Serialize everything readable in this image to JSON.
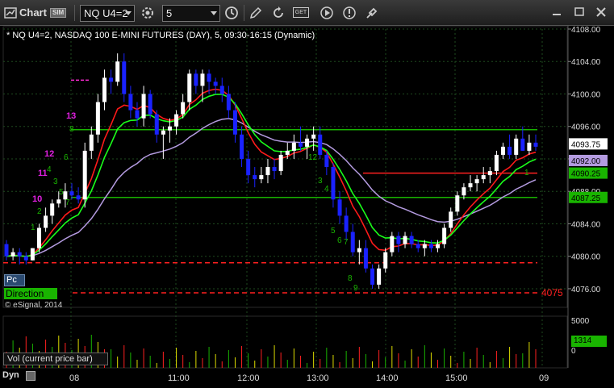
{
  "toolbar": {
    "app_label": "Chart",
    "badge": "SIM",
    "symbol_value": "NQ U4=2",
    "interval_value": "5",
    "news_label": "GET"
  },
  "chart": {
    "header": "* NQ U4=2, NASDAQ 100 E-MINI FUTURES (DAY), 5, 09:30-16:15 (Dynamic)",
    "price_ticks": [
      "4108.00",
      "4104.00",
      "4100.00",
      "4096.00",
      "4092.00",
      "4088.00",
      "4084.00",
      "4080.00",
      "4076.00"
    ],
    "last_price": "4093.75",
    "second_price": "4092.00",
    "level_4090": "4090.25",
    "level_4087": "4087.25",
    "level_4075": "4075",
    "time_labels": [
      "08",
      "11:00",
      "12:00",
      "13:00",
      "14:00",
      "15:00",
      "09"
    ],
    "indicators": {
      "pc": "Pc",
      "direction": "Direction"
    },
    "copyright": "© eSignal, 2014",
    "vol_label": "Vol (current price bar)",
    "vol_ticks": [
      "5000",
      "0"
    ],
    "vol_value": "1314",
    "bottom_label": "Dyn",
    "counts_magenta": [
      "13",
      "12",
      "11",
      "10"
    ],
    "counts_green": [
      "8",
      "4",
      "3",
      "5",
      "6",
      "7",
      "1",
      "2",
      "12",
      "3",
      "4",
      "5",
      "6",
      "7",
      "8",
      "9",
      "1"
    ]
  },
  "chart_data": {
    "type": "candlestick",
    "ylim": [
      4075,
      4108
    ],
    "candles": [
      [
        4081.5,
        4082,
        4079.5,
        4080
      ],
      [
        4080,
        4081,
        4079.5,
        4080.5
      ],
      [
        4080.5,
        4081,
        4079,
        4080
      ],
      [
        4080,
        4080.5,
        4079,
        4079.5
      ],
      [
        4079.5,
        4081,
        4079.5,
        4081
      ],
      [
        4081,
        4084,
        4080.5,
        4083.5
      ],
      [
        4083.5,
        4086,
        4083,
        4085
      ],
      [
        4085,
        4087,
        4084,
        4086.5
      ],
      [
        4086.5,
        4088,
        4086,
        4087
      ],
      [
        4087,
        4089,
        4086,
        4088
      ],
      [
        4088,
        4089,
        4087,
        4087.5
      ],
      [
        4087.5,
        4088.5,
        4086.5,
        4087
      ],
      [
        4087,
        4094,
        4086,
        4093
      ],
      [
        4093,
        4096,
        4092,
        4095
      ],
      [
        4095,
        4100,
        4094,
        4099
      ],
      [
        4099,
        4103,
        4098,
        4102
      ],
      [
        4102,
        4103,
        4100,
        4101.5
      ],
      [
        4101.5,
        4105,
        4101,
        4104
      ],
      [
        4104,
        4105,
        4099,
        4100
      ],
      [
        4100,
        4101,
        4097,
        4098
      ],
      [
        4098,
        4099,
        4096,
        4097
      ],
      [
        4097,
        4101,
        4096,
        4100
      ],
      [
        4100,
        4100.5,
        4097,
        4097.5
      ],
      [
        4097.5,
        4098,
        4094,
        4095
      ],
      [
        4095,
        4096,
        4092,
        4095.5
      ],
      [
        4095.5,
        4097,
        4094,
        4096
      ],
      [
        4096,
        4098,
        4095,
        4097.5
      ],
      [
        4097.5,
        4100,
        4097,
        4099
      ],
      [
        4099,
        4103,
        4098,
        4102.5
      ],
      [
        4102.5,
        4103,
        4100,
        4101
      ],
      [
        4101,
        4103,
        4099,
        4102.5
      ],
      [
        4102.5,
        4103,
        4100,
        4101.5
      ],
      [
        4101.5,
        4102,
        4100,
        4101
      ],
      [
        4101,
        4102,
        4099,
        4100
      ],
      [
        4100,
        4101,
        4097,
        4098
      ],
      [
        4098,
        4099,
        4094,
        4095
      ],
      [
        4095,
        4096,
        4091,
        4092
      ],
      [
        4092,
        4093,
        4089,
        4090
      ],
      [
        4090,
        4091,
        4088.5,
        4089.5
      ],
      [
        4089.5,
        4091,
        4089,
        4090
      ],
      [
        4090,
        4092,
        4089,
        4091
      ],
      [
        4091,
        4092,
        4089.5,
        4090.5
      ],
      [
        4090.5,
        4093,
        4090,
        4092.5
      ],
      [
        4092.5,
        4094,
        4092,
        4093
      ],
      [
        4093,
        4095,
        4092,
        4094
      ],
      [
        4094,
        4096,
        4093,
        4093.5
      ],
      [
        4093.5,
        4095,
        4092,
        4094.5
      ],
      [
        4094.5,
        4096,
        4093,
        4095
      ],
      [
        4095,
        4096,
        4092,
        4092.5
      ],
      [
        4092.5,
        4093,
        4090,
        4091
      ],
      [
        4091,
        4091.5,
        4086,
        4087
      ],
      [
        4087,
        4088,
        4084,
        4085
      ],
      [
        4085,
        4086,
        4082,
        4083
      ],
      [
        4083,
        4084,
        4080,
        4080.5
      ],
      [
        4080.5,
        4082,
        4079,
        4081
      ],
      [
        4081,
        4082,
        4078,
        4078.5
      ],
      [
        4078.5,
        4079,
        4076,
        4076.5
      ],
      [
        4076.5,
        4079,
        4076,
        4078.5
      ],
      [
        4078.5,
        4081,
        4078,
        4080.5
      ],
      [
        4080.5,
        4083,
        4080,
        4082.5
      ],
      [
        4082.5,
        4083,
        4080.5,
        4081.5
      ],
      [
        4081.5,
        4083,
        4081,
        4082.5
      ],
      [
        4082.5,
        4083,
        4081,
        4081.5
      ],
      [
        4081.5,
        4082,
        4080.5,
        4081
      ],
      [
        4081,
        4082,
        4080,
        4081.5
      ],
      [
        4081.5,
        4082,
        4080.5,
        4081
      ],
      [
        4081,
        4082,
        4080.5,
        4081.5
      ],
      [
        4081.5,
        4084,
        4081,
        4083.5
      ],
      [
        4083.5,
        4086,
        4083,
        4085.5
      ],
      [
        4085.5,
        4088,
        4085,
        4087.5
      ],
      [
        4087.5,
        4089,
        4087,
        4088.5
      ],
      [
        4088.5,
        4090,
        4088,
        4089
      ],
      [
        4089,
        4090,
        4088,
        4089.5
      ],
      [
        4089.5,
        4091,
        4089,
        4090
      ],
      [
        4090,
        4091,
        4089,
        4090.5
      ],
      [
        4090.5,
        4093,
        4090,
        4092.5
      ],
      [
        4092.5,
        4094,
        4092,
        4093.5
      ],
      [
        4093.5,
        4095,
        4092,
        4092.5
      ],
      [
        4092.5,
        4095,
        4092,
        4094.5
      ],
      [
        4094.5,
        4096,
        4093,
        4093
      ],
      [
        4093,
        4095,
        4092.5,
        4094
      ],
      [
        4094,
        4095,
        4093,
        4093.5
      ]
    ]
  },
  "colors": {
    "up": "#ffffff",
    "down": "#1a22ff",
    "red_line": "#ff1a1a",
    "green_line": "#1aff1a",
    "purple_line": "#b49be0",
    "level_green": "#19b400",
    "level_red": "#ff2020",
    "grid": "#1e4a1e"
  }
}
